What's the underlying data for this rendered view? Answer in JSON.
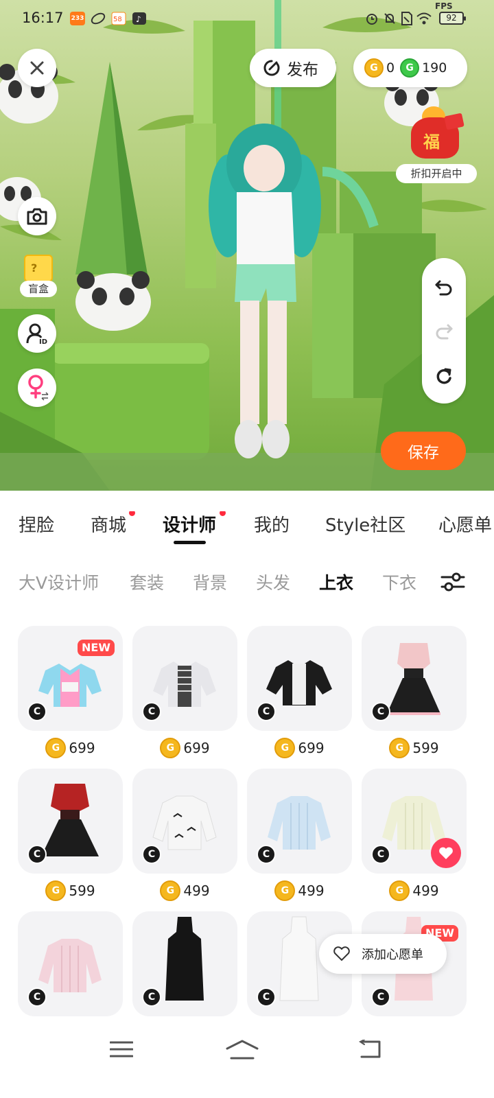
{
  "status_bar": {
    "time": "16:17",
    "notif_badge": "233",
    "fps": "FPS",
    "battery": "92"
  },
  "overlay": {
    "publish_label": "发布",
    "coins": {
      "gold": "0",
      "green": "190"
    },
    "mystery_box_label": "盲盒",
    "promo_label": "折扣开启中",
    "save_label": "保存"
  },
  "tabs": [
    {
      "label": "捏脸",
      "dot": false
    },
    {
      "label": "商城",
      "dot": true
    },
    {
      "label": "设计师",
      "dot": true,
      "active": true
    },
    {
      "label": "我的",
      "dot": false
    },
    {
      "label": "Style社区",
      "dot": false
    },
    {
      "label": "心愿单",
      "dot": false
    }
  ],
  "subtabs": [
    {
      "label": "大V设计师"
    },
    {
      "label": "套装"
    },
    {
      "label": "背景"
    },
    {
      "label": "头发"
    },
    {
      "label": "上衣",
      "active": true
    },
    {
      "label": "下衣"
    }
  ],
  "items": [
    {
      "price": "699",
      "badge": "NEW",
      "kind": "jacket-colorful"
    },
    {
      "price": "699",
      "kind": "jacket-silver"
    },
    {
      "price": "699",
      "kind": "jacket-black"
    },
    {
      "price": "599",
      "kind": "dress-pink-black"
    },
    {
      "price": "599",
      "kind": "dress-red-black"
    },
    {
      "price": "499",
      "kind": "sweater-white"
    },
    {
      "price": "499",
      "kind": "sweater-blue"
    },
    {
      "price": "499",
      "kind": "sweater-cream",
      "favorited": true
    },
    {
      "price": "",
      "kind": "sweater-pink"
    },
    {
      "price": "",
      "kind": "dress-black"
    },
    {
      "price": "",
      "kind": "dress-white"
    },
    {
      "price": "",
      "badge": "NEW",
      "kind": "dress-pink"
    }
  ],
  "wish_popup": {
    "label": "添加心愿单"
  },
  "colors": {
    "accent": "#ff6a1a",
    "dot": "#ff2a3d",
    "coin_gold": "#f5b71e",
    "coin_green": "#3ec94a"
  }
}
